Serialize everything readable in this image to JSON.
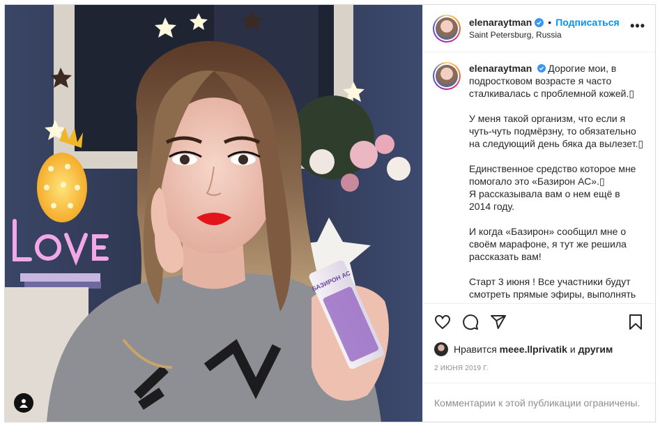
{
  "post": {
    "username": "elenaraytman",
    "follow_label": "Подписаться",
    "dot": "•",
    "location": "Saint Petersburg, Russia",
    "more": "•••",
    "caption": [
      "Дорогие мои, в подростковом возрасте я часто сталкивалась с проблемной кожей.▯",
      "У меня такой организм, что если я чуть-чуть подмёрзну, то обязательно на следующий день бяка да вылезет.▯",
      "Единственное средство которое мне помогало это «Базирон АС».▯\nЯ рассказывала вам о нем ещё в 2014 году.",
      "И когда «Базирон» сообщил мне о своём марафоне, я тут же решила рассказать вам!",
      "Старт 3 июня ! Все участники будут смотреть прямые эфиры, выполнять"
    ],
    "likes": {
      "prefix": "Нравится",
      "user": "meee.llprivatik",
      "and": "и",
      "others": "другим"
    },
    "date": "2 июня 2019 г.",
    "comments_disabled": "Комментарии к этой публикации ограничены."
  },
  "photo": {
    "product_label": "БАЗИРОН АС",
    "neon_text": "LOVE"
  },
  "colors": {
    "accent": "#0095f6",
    "verified": "#3897f0",
    "muted": "#8e8e8e",
    "lipstick": "#e2151d",
    "tube_purple": "#9b6fc4"
  },
  "icons": [
    "heart-icon",
    "comment-icon",
    "share-icon",
    "bookmark-icon",
    "verified-badge-icon",
    "user-tag-icon",
    "more-options-icon"
  ]
}
